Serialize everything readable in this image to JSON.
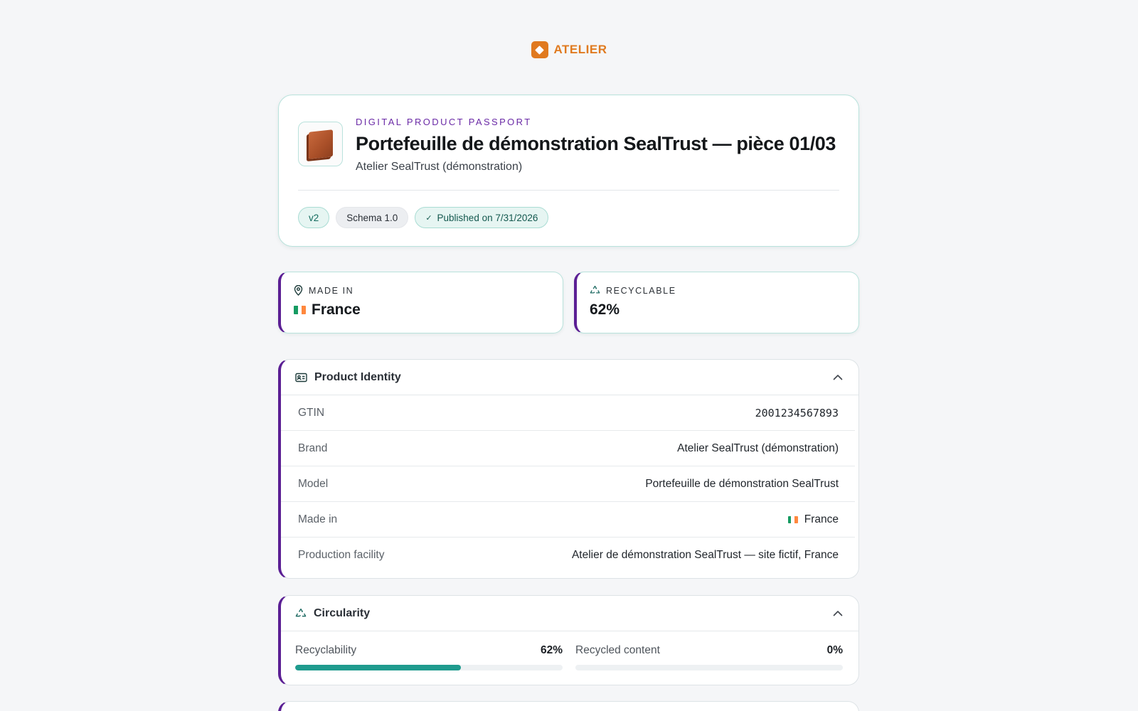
{
  "brand": {
    "name": "ATELIER",
    "color": "#e07a1f"
  },
  "hero": {
    "eyebrow": "DIGITAL PRODUCT PASSPORT",
    "title": "Portefeuille de démonstration SealTrust — pièce 01/03",
    "subtitle": "Atelier SealTrust (démonstration)",
    "pills": {
      "version": "v2",
      "schema": "Schema 1.0",
      "published": "Published on 7/31/2026"
    }
  },
  "stats": {
    "made_in": {
      "label": "MADE IN",
      "value": "France",
      "icon": "map-pin-icon"
    },
    "recyclable": {
      "label": "RECYCLABLE",
      "value": "62%",
      "icon": "recycle-icon"
    }
  },
  "identity": {
    "title": "Product Identity",
    "icon": "id-card-icon",
    "rows": [
      {
        "label": "GTIN",
        "value": "2001234567893"
      },
      {
        "label": "Brand",
        "value": "Atelier SealTrust (démonstration)"
      },
      {
        "label": "Model",
        "value": "Portefeuille de démonstration SealTrust"
      },
      {
        "label": "Made in",
        "value": "France"
      },
      {
        "label": "Production facility",
        "value": "Atelier de démonstration SealTrust — site fictif, France"
      }
    ]
  },
  "circularity": {
    "title": "Circularity",
    "icon": "recycle-icon",
    "metrics": [
      {
        "label": "Recyclability",
        "value": "62%",
        "fraction": 0.62
      },
      {
        "label": "Recycled content",
        "value": "0%",
        "fraction": 0
      }
    ]
  },
  "colors": {
    "accent_purple": "#5b1f94",
    "teal": "#1f9b8e",
    "card_border": "#b9e2dc"
  }
}
